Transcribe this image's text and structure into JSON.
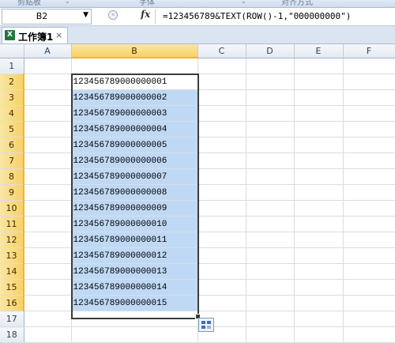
{
  "ribbon": {
    "groups": [
      "剪贴板",
      "字体",
      "对齐方式"
    ]
  },
  "formula_bar": {
    "name_box": "B2",
    "fx_label": "fx",
    "formula": "=123456789&TEXT(ROW()-1,\"000000000\")"
  },
  "workbook_tab": {
    "title": "工作簿1",
    "close": "×"
  },
  "grid": {
    "columns": [
      "A",
      "B",
      "C",
      "D",
      "E",
      "F"
    ],
    "active_column": "B",
    "rows": [
      {
        "num": "1",
        "b": ""
      },
      {
        "num": "2",
        "b": "123456789000000001"
      },
      {
        "num": "3",
        "b": "123456789000000002"
      },
      {
        "num": "4",
        "b": "123456789000000003"
      },
      {
        "num": "5",
        "b": "123456789000000004"
      },
      {
        "num": "6",
        "b": "123456789000000005"
      },
      {
        "num": "7",
        "b": "123456789000000006"
      },
      {
        "num": "8",
        "b": "123456789000000007"
      },
      {
        "num": "9",
        "b": "123456789000000008"
      },
      {
        "num": "10",
        "b": "123456789000000009"
      },
      {
        "num": "11",
        "b": "123456789000000010"
      },
      {
        "num": "12",
        "b": "123456789000000011"
      },
      {
        "num": "13",
        "b": "123456789000000012"
      },
      {
        "num": "14",
        "b": "123456789000000013"
      },
      {
        "num": "15",
        "b": "123456789000000014"
      },
      {
        "num": "16",
        "b": "123456789000000015"
      },
      {
        "num": "17",
        "b": ""
      },
      {
        "num": "18",
        "b": ""
      }
    ]
  },
  "colors": {
    "selection_fill": "#bfd9f5",
    "header_highlight": "#f8d167",
    "tab_bar": "#dbe5f1"
  }
}
